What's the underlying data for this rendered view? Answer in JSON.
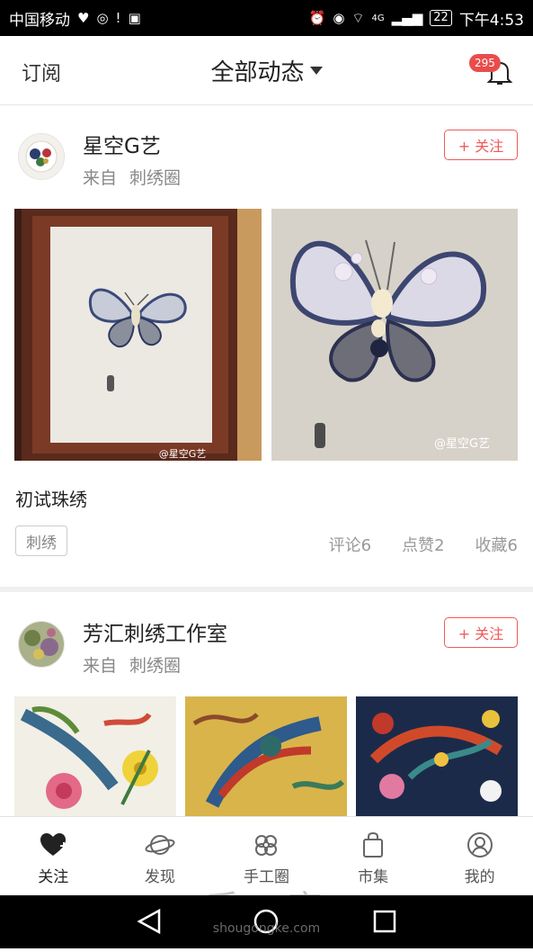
{
  "status_bar": {
    "carrier": "中国移动",
    "network": "4G",
    "battery": "22",
    "time": "下午4:53"
  },
  "header": {
    "subscribe_label": "订阅",
    "title": "全部动态",
    "notification_count": "295"
  },
  "posts": [
    {
      "username": "星空G艺",
      "from_label": "来自",
      "circle": "刺绣圈",
      "follow_label": "+ 关注",
      "post_title": "初试珠绣",
      "tag": "刺绣",
      "comments": "评论6",
      "likes": "点赞2",
      "favorites": "收藏6",
      "image_watermark_1": "@星空G艺",
      "image_watermark_2": "@星空G艺"
    },
    {
      "username": "芳汇刺绣工作室",
      "from_label": "来自",
      "circle": "刺绣圈",
      "follow_label": "+ 关注"
    }
  ],
  "tabs": [
    {
      "label": "关注",
      "icon": "heart-icon",
      "active": true
    },
    {
      "label": "发现",
      "icon": "planet-icon",
      "active": false
    },
    {
      "label": "手工圈",
      "icon": "flower-icon",
      "active": false
    },
    {
      "label": "市集",
      "icon": "bag-icon",
      "active": false
    },
    {
      "label": "我的",
      "icon": "user-icon",
      "active": false
    }
  ],
  "watermark": {
    "text": "手工客",
    "url": "shougongke.com"
  },
  "colors": {
    "accent": "#ef5a5a",
    "badge": "#ea4c4c"
  }
}
